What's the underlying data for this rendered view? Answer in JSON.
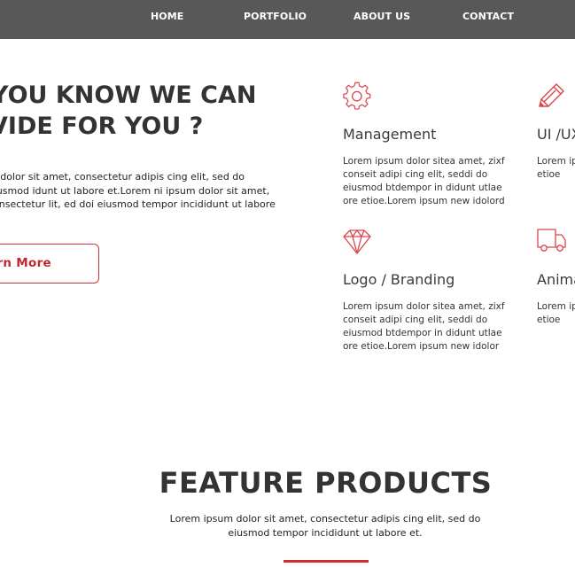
{
  "nav": {
    "items": [
      {
        "label": "HOME"
      },
      {
        "label": "PORTFOLIO"
      },
      {
        "label": "ABOUT US"
      },
      {
        "label": "CONTACT"
      }
    ]
  },
  "hero": {
    "title_line1": "YOU KNOW WE CAN",
    "title_line2": "VIDE FOR YOU ?",
    "text": "m dolor sit amet, consectetur adipis cing elit, sed do eiusmod idunt ut labore et.Lorem ni ipsum dolor sit amet, consectetur lit, ed doi eiusmod tempor incididunt ut labore et.",
    "button_label": "arn More"
  },
  "services": [
    {
      "title": "Management",
      "icon": "gear-icon",
      "text": "Lorem ipsum dolor sitea amet, zixf conseit adipi cing elit, seddi do eiusmod btdempor in didunt utlae ore etioe.Lorem ipsum new idolord"
    },
    {
      "title": "UI /UX",
      "icon": "pencil-icon",
      "text": "Lorem ipsum conseit a eiusmod ore etioe"
    },
    {
      "title": "Logo / Branding",
      "icon": "diamond-icon",
      "text": "Lorem ipsum dolor sitea amet, zixf conseit adipi cing elit, seddi do eiusmod btdempor in didunt utlae ore etioe.Lorem ipsum new idolor"
    },
    {
      "title": "Anima",
      "icon": "truck-icon",
      "text": "Lorem ip conseit a eiusmod ore etioe"
    }
  ],
  "feature": {
    "title": "FEATURE PRODUCTS",
    "text": "Lorem ipsum dolor sit amet, consectetur adipis cing elit, sed do eiusmod tempor incididunt ut labore et."
  },
  "colors": {
    "nav_bg": "#585858",
    "accent": "#d62a2f",
    "text": "#333333"
  }
}
